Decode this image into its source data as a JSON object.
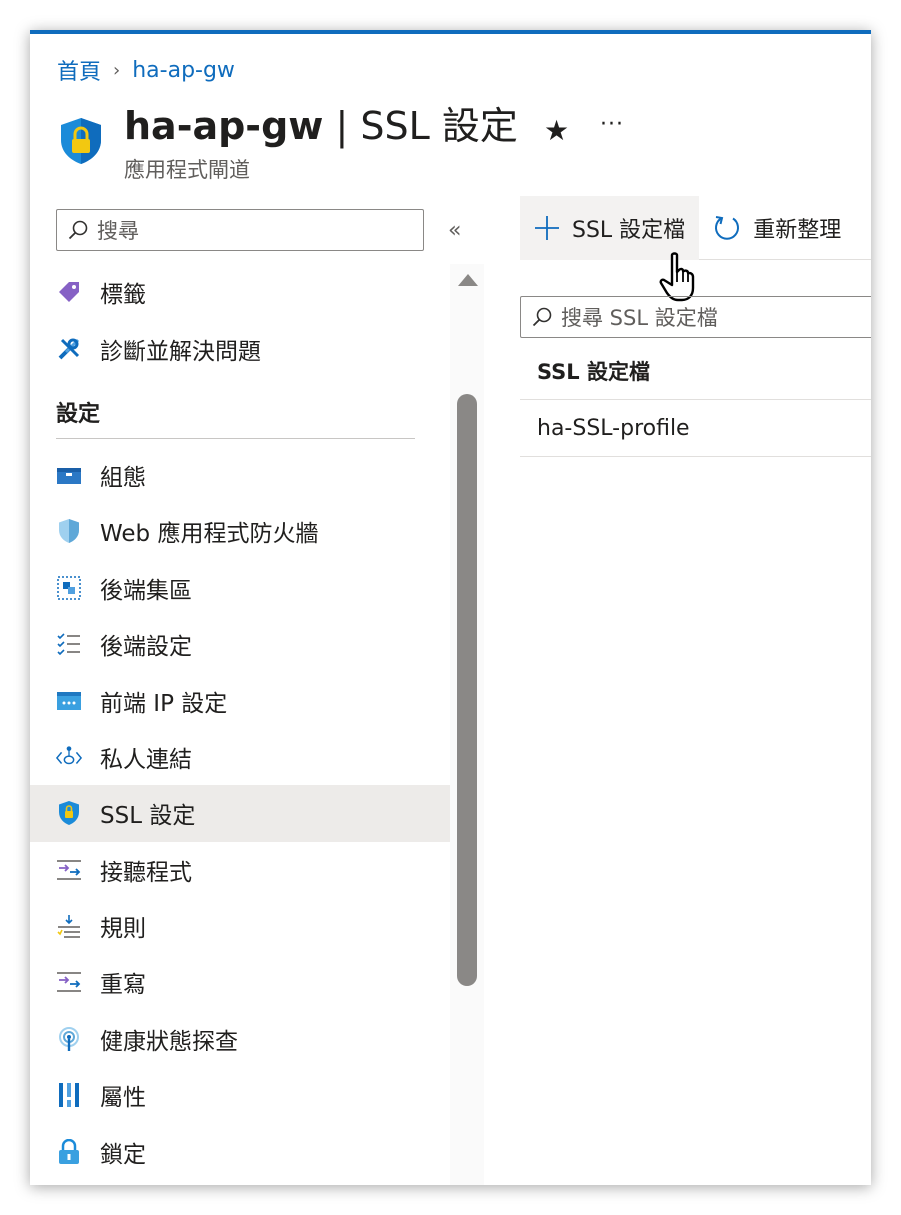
{
  "breadcrumb": {
    "home": "首頁",
    "separator": "›",
    "current": "ha-ap-gw"
  },
  "header": {
    "resource_name": "ha-ap-gw",
    "divider": " | ",
    "page_name": "SSL 設定",
    "subtitle": "應用程式閘道",
    "star": "★",
    "more": "···"
  },
  "nav_search": {
    "placeholder": "搜尋"
  },
  "collapse": "«",
  "nav": {
    "items_top": [
      {
        "label": "標籤",
        "icon": "tag-icon"
      },
      {
        "label": "診斷並解決問題",
        "icon": "wrench-icon"
      }
    ],
    "section_label": "設定",
    "items": [
      {
        "label": "組態",
        "icon": "configuration-icon"
      },
      {
        "label": "Web 應用程式防火牆",
        "icon": "waf-shield-icon"
      },
      {
        "label": "後端集區",
        "icon": "backend-pool-icon"
      },
      {
        "label": "後端設定",
        "icon": "backend-settings-icon"
      },
      {
        "label": "前端 IP 設定",
        "icon": "frontend-ip-icon"
      },
      {
        "label": "私人連結",
        "icon": "private-link-icon"
      },
      {
        "label": "SSL 設定",
        "icon": "ssl-shield-icon",
        "selected": true
      },
      {
        "label": "接聽程式",
        "icon": "listener-icon"
      },
      {
        "label": "規則",
        "icon": "rules-icon"
      },
      {
        "label": "重寫",
        "icon": "rewrite-icon"
      },
      {
        "label": "健康狀態探查",
        "icon": "health-probe-icon"
      },
      {
        "label": "屬性",
        "icon": "properties-icon"
      },
      {
        "label": "鎖定",
        "icon": "lock-icon"
      }
    ]
  },
  "toolbar": {
    "add_label": "SSL 設定檔",
    "refresh_label": "重新整理"
  },
  "list_search": {
    "placeholder": "搜尋 SSL 設定檔"
  },
  "table": {
    "header": "SSL 設定檔",
    "rows": [
      "ha-SSL-profile"
    ]
  },
  "colors": {
    "accent": "#0f6cbd",
    "selected_bg": "#edebe9"
  }
}
